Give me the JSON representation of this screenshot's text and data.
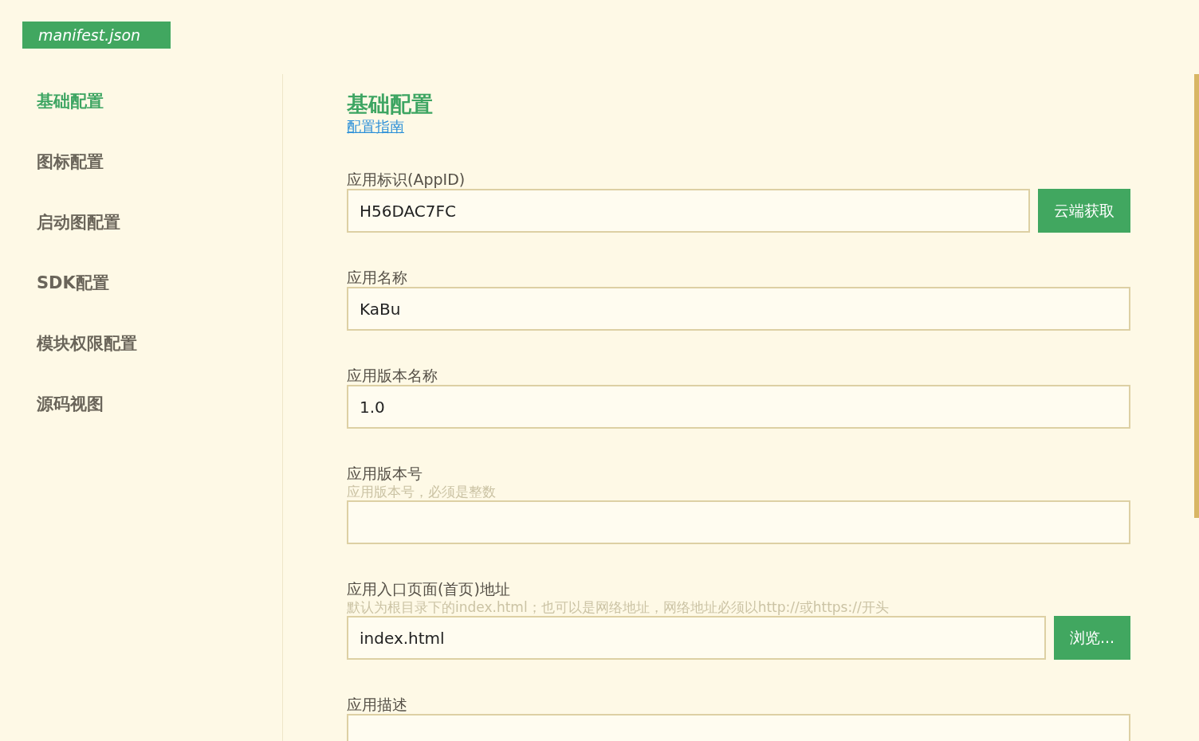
{
  "file_tab": "manifest.json",
  "sidebar": {
    "items": [
      {
        "label": "基础配置",
        "selected": true
      },
      {
        "label": "图标配置",
        "selected": false
      },
      {
        "label": "启动图配置",
        "selected": false
      },
      {
        "label": "SDK配置",
        "selected": false
      },
      {
        "label": "模块权限配置",
        "selected": false
      },
      {
        "label": "源码视图",
        "selected": false
      }
    ]
  },
  "section": {
    "title": "基础配置",
    "guide_link": "配置指南"
  },
  "fields": [
    {
      "label": "应用标识(AppID)",
      "value": "H56DAC7FC",
      "button": "云端获取"
    },
    {
      "label": "应用名称",
      "value": "KaBu"
    },
    {
      "label": "应用版本名称",
      "value": "1.0"
    },
    {
      "label": "应用版本号",
      "hint": "应用版本号，必须是整数"
    },
    {
      "label": "应用入口页面(首页)地址",
      "hint": "默认为根目录下的index.html；也可以是网络地址，网络地址必须以http://或https://开头",
      "value": "index.html",
      "button": "浏览..."
    },
    {
      "label": "应用描述"
    }
  ]
}
